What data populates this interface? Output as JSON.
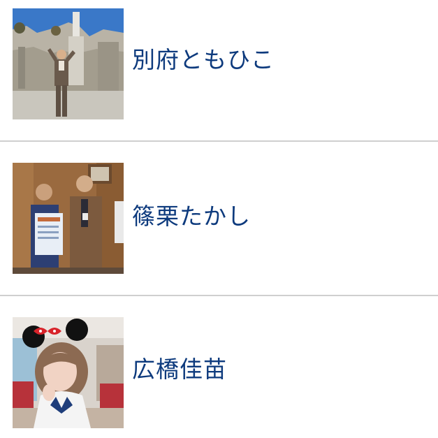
{
  "members": [
    {
      "name": "別府ともひこ",
      "photo": "member-photo-beppu"
    },
    {
      "name": "篠栗たかし",
      "photo": "member-photo-sasaguri"
    },
    {
      "name": "広橋佳苗",
      "photo": "member-photo-hirohashi"
    }
  ],
  "colors": {
    "name_text": "#0d3a7d",
    "divider": "#cfcfcf",
    "background": "#ffffff"
  }
}
